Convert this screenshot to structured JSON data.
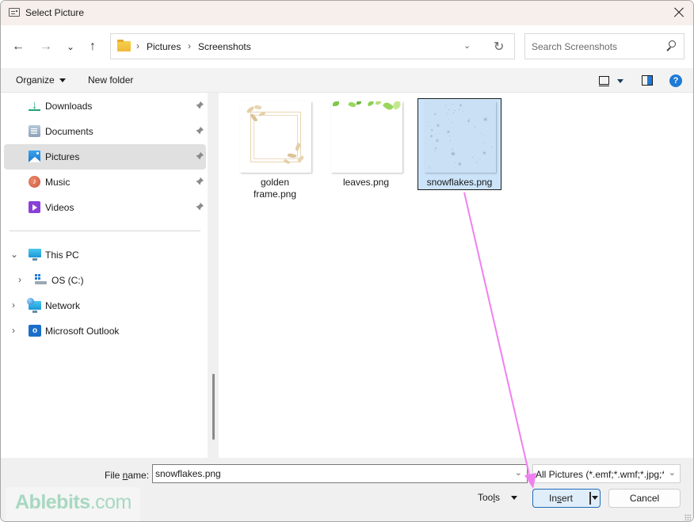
{
  "window": {
    "title": "Select Picture",
    "close_label": "Close"
  },
  "navigation": {
    "back": "←",
    "forward": "→",
    "recent": "⌄",
    "up": "↑",
    "breadcrumb": [
      "Pictures",
      "Screenshots"
    ],
    "refresh": "↻",
    "search_placeholder": "Search Screenshots"
  },
  "toolbar": {
    "organize_label": "Organize",
    "new_folder_label": "New folder",
    "help_label": "?"
  },
  "sidebar": {
    "quick_access": [
      {
        "label": "Downloads",
        "icon": "download-icon",
        "pinned": true,
        "selected": false
      },
      {
        "label": "Documents",
        "icon": "documents-icon",
        "pinned": true,
        "selected": false
      },
      {
        "label": "Pictures",
        "icon": "pictures-icon",
        "pinned": true,
        "selected": true
      },
      {
        "label": "Music",
        "icon": "music-icon",
        "pinned": true,
        "selected": false
      },
      {
        "label": "Videos",
        "icon": "videos-icon",
        "pinned": true,
        "selected": false
      }
    ],
    "tree": [
      {
        "label": "This PC",
        "icon": "computer-icon",
        "expanded": true,
        "level": 0
      },
      {
        "label": "OS (C:)",
        "icon": "drive-icon",
        "expanded": false,
        "level": 1
      },
      {
        "label": "Network",
        "icon": "network-icon",
        "expanded": false,
        "level": 0
      },
      {
        "label": "Microsoft Outlook",
        "icon": "outlook-icon",
        "expanded": false,
        "level": 0
      }
    ],
    "pin_glyph": "📌"
  },
  "files": [
    {
      "name": "golden\nframe.png",
      "name_line1": "golden",
      "name_line2": "frame.png",
      "selected": false
    },
    {
      "name": "leaves.png",
      "name_line1": "leaves.png",
      "name_line2": "",
      "selected": false
    },
    {
      "name": "snowflakes.png",
      "name_line1": "snowflakes.png",
      "name_line2": "",
      "selected": true
    }
  ],
  "footer": {
    "file_name_label_prefix": "File ",
    "file_name_label_underlined": "n",
    "file_name_label_suffix": "ame:",
    "file_name_value": "snowflakes.png",
    "file_type_value": "All Pictures (*.emf;*.wmf;*.jpg;*",
    "tools_prefix": "Too",
    "tools_underlined": "l",
    "tools_suffix": "s",
    "insert_prefix": "In",
    "insert_underlined": "s",
    "insert_suffix": "ert",
    "cancel_label": "Cancel"
  },
  "watermark": {
    "brand": "Ablebits",
    "domain": ".com"
  },
  "annotation": {
    "color": "#f080f0",
    "description": "arrow from selected snowflakes.png to Insert button"
  }
}
